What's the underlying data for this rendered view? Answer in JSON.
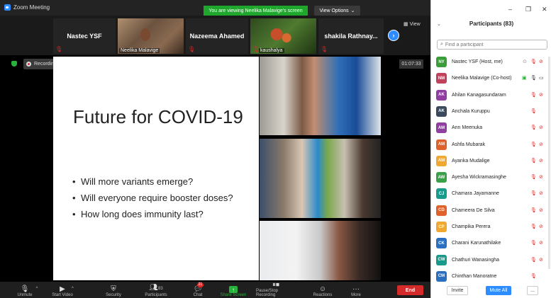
{
  "window": {
    "title": "Zoom Meeting",
    "viewing_banner": "You are viewing Neelika Malavige's screen",
    "view_options": "View Options",
    "view_button": "View"
  },
  "video_strip": [
    {
      "name": "Nastec YSF",
      "label": "",
      "type": "name"
    },
    {
      "name": "",
      "label": "Neelika Malavige",
      "type": "photo"
    },
    {
      "name": "Nazeema Ahamed",
      "label": "",
      "type": "name"
    },
    {
      "name": "",
      "label": "kaushalya",
      "type": "photo"
    },
    {
      "name": "shakila Rathnay...",
      "label": "",
      "type": "name"
    }
  ],
  "recording": {
    "label": "Recording...",
    "pause": "❚❚",
    "stop": "■"
  },
  "timer": "01:07:33",
  "slide": {
    "title": "Future for COVID-19",
    "bullets": [
      "Will more variants emerge?",
      "Will everyone require booster doses?",
      "How long does immunity last?"
    ]
  },
  "toolbar": {
    "unmute": "Unmute",
    "start_video": "Start Video",
    "security": "Security",
    "participants": "Participants",
    "participants_count": "83",
    "chat": "Chat",
    "chat_badge": "21",
    "share_screen": "Share Screen",
    "pause_recording": "Pause/Stop Recording",
    "reactions": "Reactions",
    "more": "More",
    "end": "End"
  },
  "participants_panel": {
    "title": "Participants (83)",
    "search_placeholder": "Find a participant",
    "invite": "Invite",
    "mute_all": "Mute All",
    "more": "...",
    "participants": [
      {
        "initials": "NY",
        "name": "Nastec YSF (Host, me)",
        "color": "#3a9d3a"
      },
      {
        "initials": "NM",
        "name": "Neelika Malavige (Co-host)",
        "color": "#c2405a"
      },
      {
        "initials": "AK",
        "name": "Ahilan Kanagasundaram",
        "color": "#8e3fa0"
      },
      {
        "initials": "AK",
        "name": "Anchala Kuruppu",
        "color": "#3a4a5c"
      },
      {
        "initials": "AM",
        "name": "Ann Meenuka",
        "color": "#8e3fa0"
      },
      {
        "initials": "AM",
        "name": "Ashfa Mubarak",
        "color": "#e0622a"
      },
      {
        "initials": "AM",
        "name": "Ayanka Mudalige",
        "color": "#f0a830"
      },
      {
        "initials": "AW",
        "name": "Ayesha Wickramasinghe",
        "color": "#3aa14a"
      },
      {
        "initials": "CJ",
        "name": "Chamara Jayamanne",
        "color": "#1a9a8a"
      },
      {
        "initials": "CD",
        "name": "Chameera De Silva",
        "color": "#e0622a"
      },
      {
        "initials": "CP",
        "name": "Champika Perera",
        "color": "#f0a830"
      },
      {
        "initials": "CK",
        "name": "Charani Karunathilake",
        "color": "#2a6fc0"
      },
      {
        "initials": "CW",
        "name": "Chathuri Wanasingha",
        "color": "#1a9a8a"
      },
      {
        "initials": "CM",
        "name": "Chinthan Manoratne",
        "color": "#2a6fc0"
      }
    ]
  }
}
